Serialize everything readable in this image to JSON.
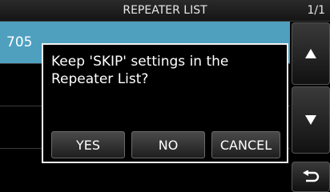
{
  "title_bar": {
    "title": "REPEATER LIST",
    "page": "1/1"
  },
  "list": {
    "rows": [
      {
        "text": "705",
        "selected": true
      },
      {
        "text": "",
        "selected": false
      },
      {
        "text": "",
        "selected": false
      },
      {
        "text": "",
        "selected": false
      }
    ]
  },
  "dialog": {
    "message": "Keep 'SKIP' settings in the Repeater List?",
    "yes_label": "YES",
    "no_label": "NO",
    "cancel_label": "CANCEL"
  },
  "side_buttons": {
    "up_icon": "triangle-up-icon",
    "down_icon": "triangle-down-icon",
    "back_icon": "return-arrow-icon"
  },
  "colors": {
    "selected_row": "#4fa0bf",
    "background": "#000000",
    "dialog_border": "#f2f2f2"
  }
}
